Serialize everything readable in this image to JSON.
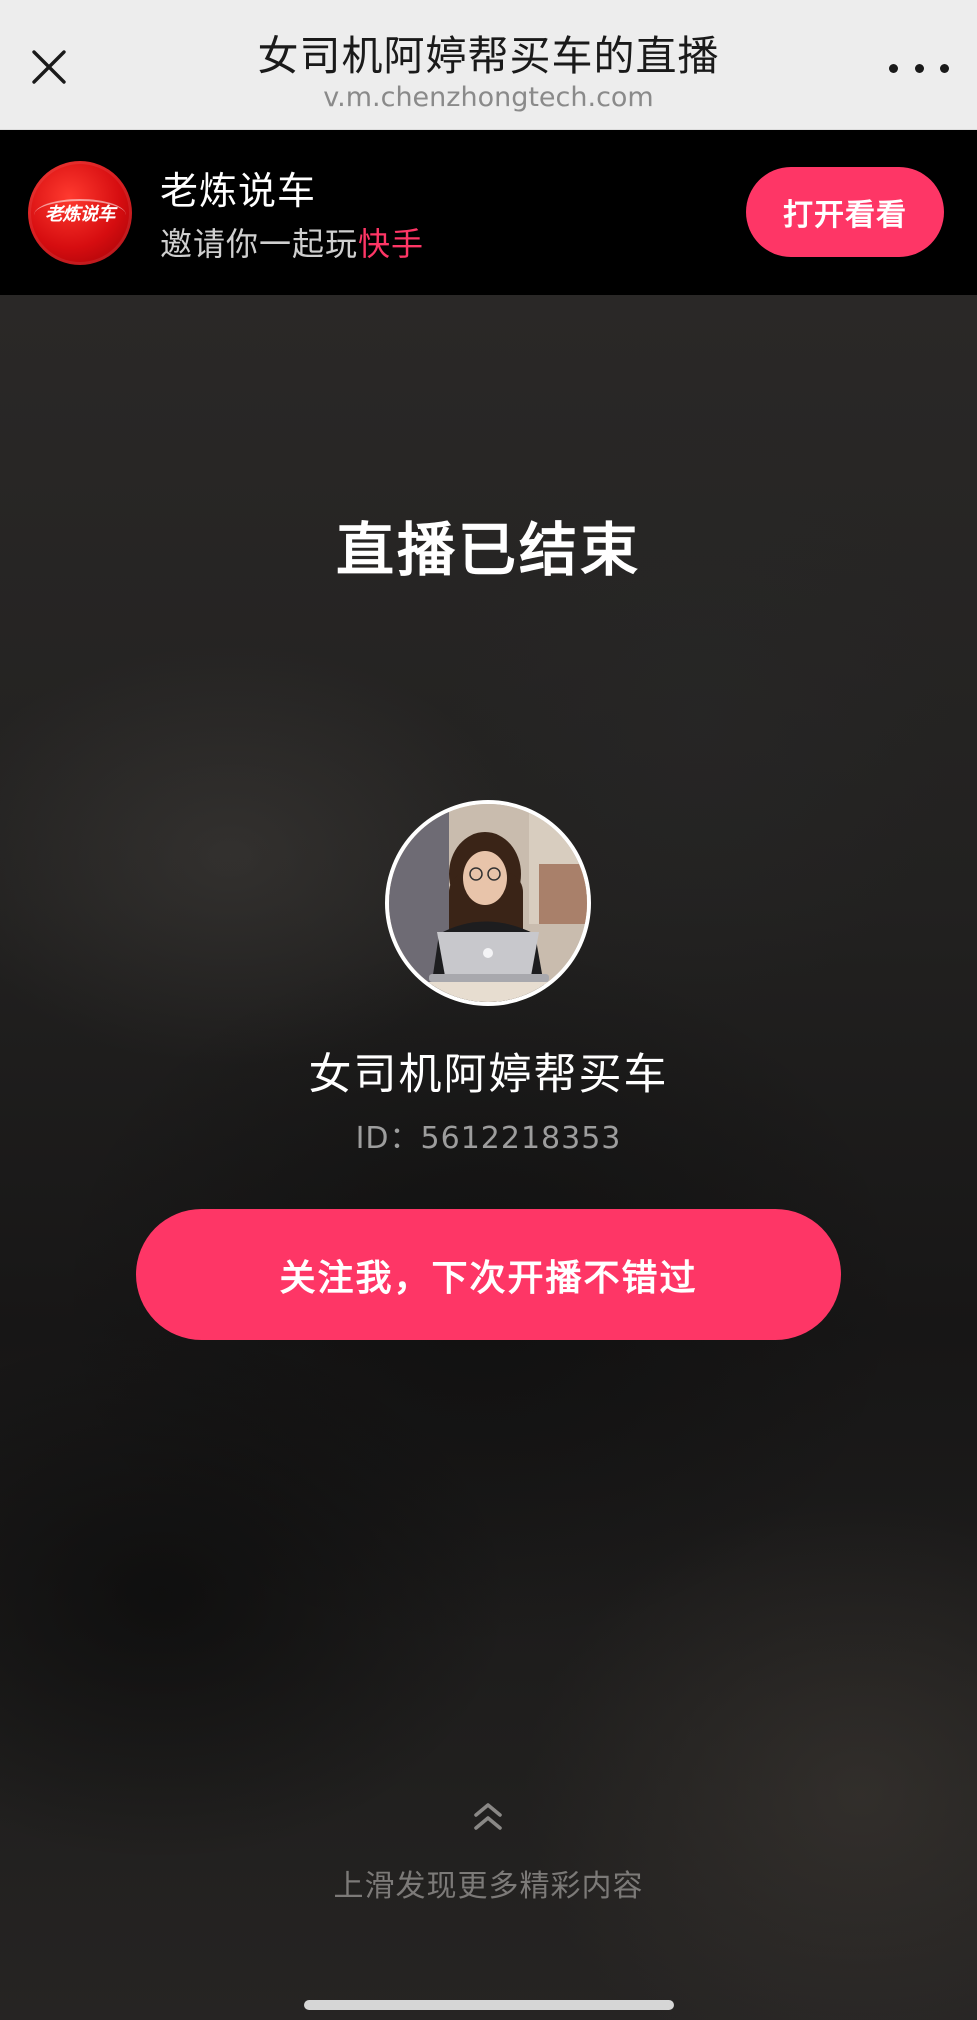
{
  "navbar": {
    "title": "女司机阿婷帮买车的直播",
    "url": "v.m.chenzhongtech.com",
    "close_icon": "close-icon",
    "more_icon": "more-dots-icon"
  },
  "banner": {
    "avatar_text": "老炼说车",
    "name": "老炼说车",
    "invite_prefix": "邀请你一起玩",
    "invite_app": "快手",
    "open_button": "打开看看"
  },
  "main": {
    "ended_title": "直播已结束",
    "host_name": "女司机阿婷帮买车",
    "host_id": "ID：5612218353",
    "follow_button": "关注我，下次开播不错过",
    "swipe_icon": "double-chevron-up-icon",
    "swipe_hint": "上滑发现更多精彩内容"
  },
  "colors": {
    "accent": "#fe3666",
    "navbar_bg": "#ededed",
    "banner_bg": "#000000",
    "page_bg": "#1b1a1a"
  }
}
